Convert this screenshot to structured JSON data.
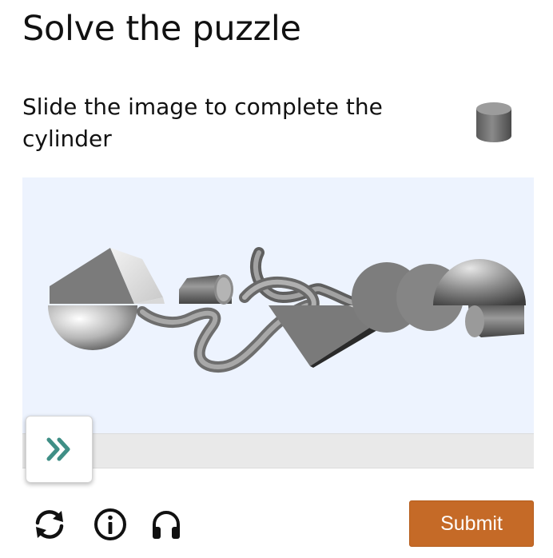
{
  "title": "Solve the puzzle",
  "instruction": "Slide the image to complete the cylinder",
  "hint_icon": "cylinder-icon",
  "slider": {
    "handle_icon": "double-chevron-right-icon",
    "position": 0,
    "accent_color": "#3f8f86"
  },
  "footer": {
    "refresh_icon": "refresh-icon",
    "info_icon": "info-icon",
    "audio_icon": "headphones-icon"
  },
  "submit_label": "Submit",
  "colors": {
    "submit": "#c56a27",
    "puzzle_background": "#edf3fe",
    "track": "#e9e9e9"
  }
}
